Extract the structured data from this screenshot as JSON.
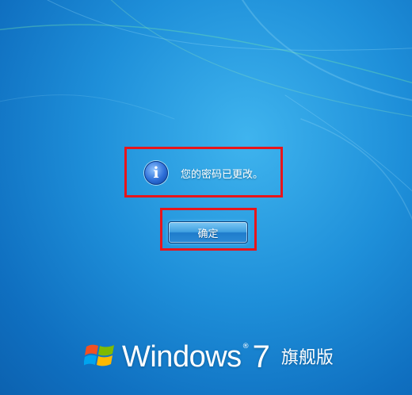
{
  "message": {
    "icon": "info-icon",
    "text": "您的密码已更改。"
  },
  "ok_button": {
    "label": "确定"
  },
  "branding": {
    "logo": "windows-flag-icon",
    "product": "Windows",
    "registered": "®",
    "version": "7",
    "edition": "旗舰版"
  },
  "colors": {
    "annotation_border": "#e8151b",
    "background": "#1e8fd9"
  }
}
